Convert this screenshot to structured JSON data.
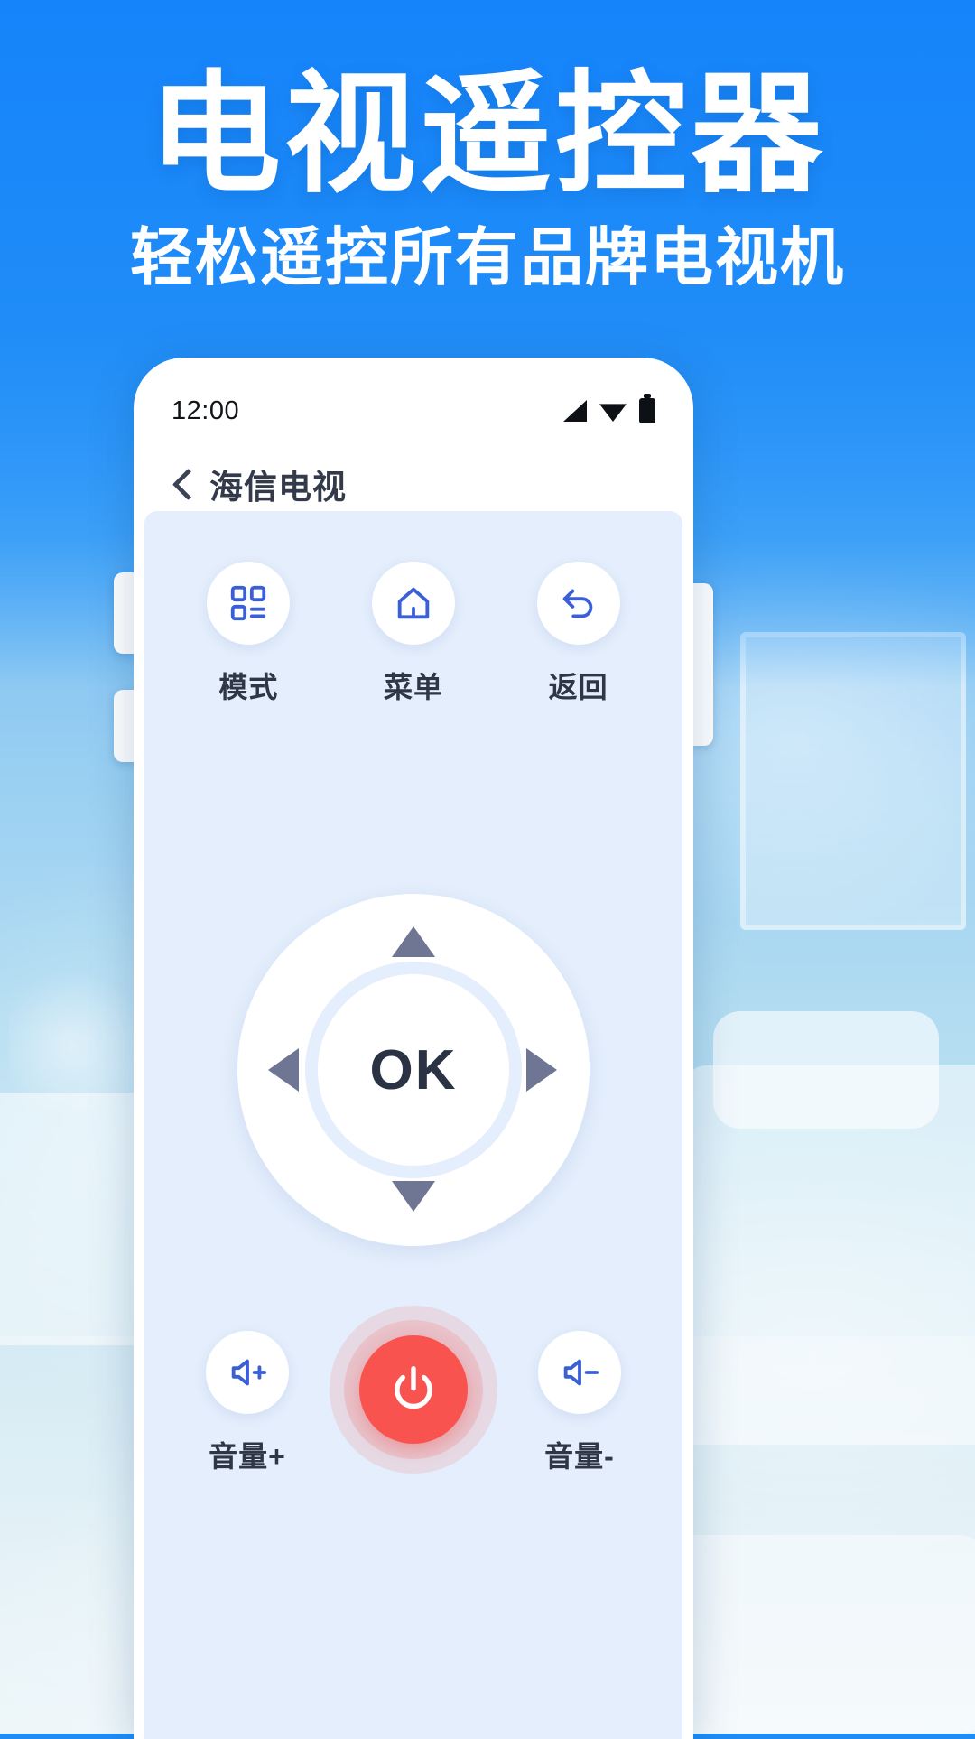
{
  "banner": {
    "main_title": "电视遥控器",
    "sub_title": "轻松遥控所有品牌电视机",
    "bg_color": "#1f8cf5"
  },
  "phone": {
    "status_bar": {
      "time": "12:00",
      "icons": [
        "signal-icon",
        "wifi-icon",
        "battery-icon"
      ]
    },
    "app_bar": {
      "back_icon": "chevron-left-icon",
      "title": "海信电视"
    },
    "remote": {
      "panel_color": "#e4eefc",
      "accent_color": "#3b5fd6",
      "power_color": "#f8534f",
      "top_buttons": [
        {
          "label": "模式",
          "icon": "grid-apps-icon"
        },
        {
          "label": "菜单",
          "icon": "home-icon"
        },
        {
          "label": "返回",
          "icon": "return-arrow-icon"
        }
      ],
      "dpad": {
        "ok_label": "OK",
        "up": "arrow-up-icon",
        "down": "arrow-down-icon",
        "left": "arrow-left-icon",
        "right": "arrow-right-icon"
      },
      "bottom_buttons": [
        {
          "label": "音量+",
          "icon": "volume-up-icon"
        },
        {
          "label": "音量-",
          "icon": "volume-down-icon"
        }
      ],
      "power": {
        "icon": "power-icon"
      }
    }
  }
}
